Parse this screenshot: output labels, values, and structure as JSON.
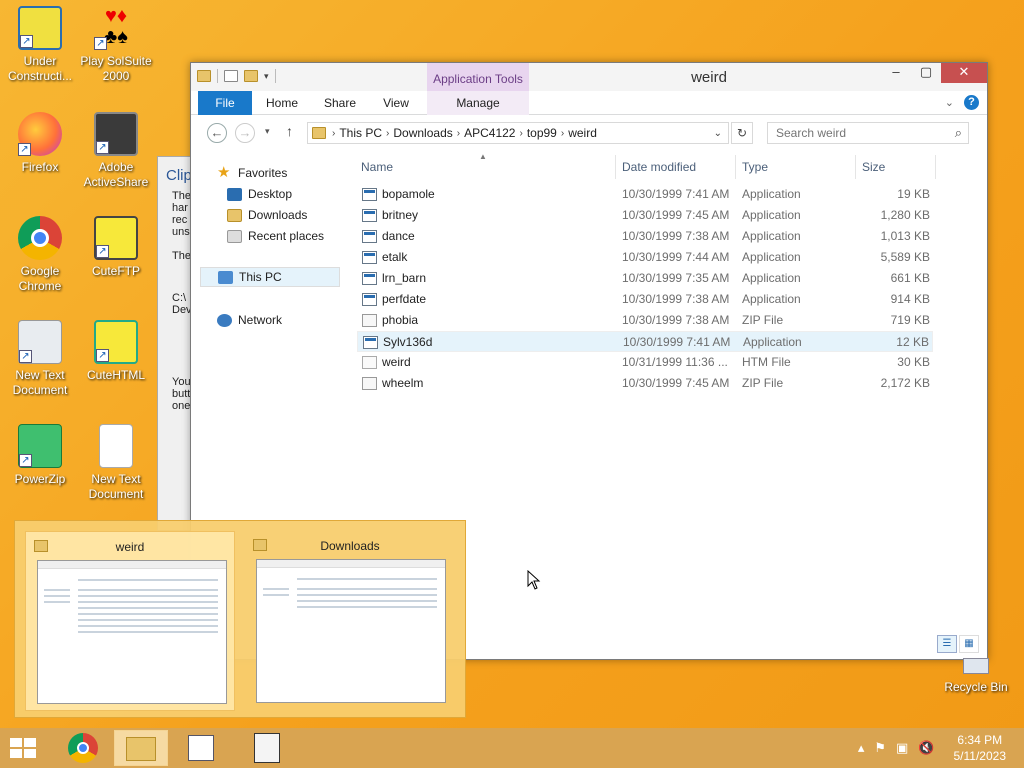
{
  "desktop": {
    "icons": [
      {
        "label": "Under Constructi...",
        "name": "desktop-icon-under-construction"
      },
      {
        "label": "Play SolSuite 2000",
        "name": "desktop-icon-solsuite"
      },
      {
        "label": "Firefox",
        "name": "desktop-icon-firefox"
      },
      {
        "label": "Adobe ActiveShare",
        "name": "desktop-icon-adobe-activeshare"
      },
      {
        "label": "Google Chrome",
        "name": "desktop-icon-google-chrome"
      },
      {
        "label": "CuteFTP",
        "name": "desktop-icon-cuteftp"
      },
      {
        "label": "New Text Document",
        "name": "desktop-icon-new-text-document-1"
      },
      {
        "label": "CuteHTML",
        "name": "desktop-icon-cutehtml"
      },
      {
        "label": "PowerZip",
        "name": "desktop-icon-powerzip"
      },
      {
        "label": "New Text Document",
        "name": "desktop-icon-new-text-document-2"
      }
    ],
    "recycle_bin": "Recycle Bin",
    "bg_window": {
      "title": "Clip",
      "lines": [
        "The",
        "har",
        "rec",
        "uns",
        "The",
        "C:\\",
        "Dev",
        "You",
        "butt",
        "one"
      ]
    }
  },
  "explorer": {
    "title": "weird",
    "contextual_tab": "Application Tools",
    "ribbon_tabs": {
      "file": "File",
      "home": "Home",
      "share": "Share",
      "view": "View",
      "manage": "Manage"
    },
    "help": "?",
    "breadcrumb": [
      "This PC",
      "Downloads",
      "APC4122",
      "top99",
      "weird"
    ],
    "search_placeholder": "Search weird",
    "nav": {
      "favorites": "Favorites",
      "desktop": "Desktop",
      "downloads": "Downloads",
      "recent": "Recent places",
      "this_pc": "This PC",
      "network": "Network"
    },
    "columns": {
      "name": "Name",
      "date": "Date modified",
      "type": "Type",
      "size": "Size"
    },
    "files": [
      {
        "name": "bopamole",
        "date": "10/30/1999 7:41 AM",
        "type": "Application",
        "size": "19 KB",
        "kind": "app"
      },
      {
        "name": "britney",
        "date": "10/30/1999 7:45 AM",
        "type": "Application",
        "size": "1,280 KB",
        "kind": "app"
      },
      {
        "name": "dance",
        "date": "10/30/1999 7:38 AM",
        "type": "Application",
        "size": "1,013 KB",
        "kind": "app"
      },
      {
        "name": "etalk",
        "date": "10/30/1999 7:44 AM",
        "type": "Application",
        "size": "5,589 KB",
        "kind": "app"
      },
      {
        "name": "lrn_barn",
        "date": "10/30/1999 7:35 AM",
        "type": "Application",
        "size": "661 KB",
        "kind": "app"
      },
      {
        "name": "perfdate",
        "date": "10/30/1999 7:38 AM",
        "type": "Application",
        "size": "914 KB",
        "kind": "app"
      },
      {
        "name": "phobia",
        "date": "10/30/1999 7:38 AM",
        "type": "ZIP File",
        "size": "719 KB",
        "kind": "zip"
      },
      {
        "name": "Sylv136d",
        "date": "10/30/1999 7:41 AM",
        "type": "Application",
        "size": "12 KB",
        "kind": "app"
      },
      {
        "name": "weird",
        "date": "10/31/1999 11:36 ...",
        "type": "HTM File",
        "size": "30 KB",
        "kind": "htm"
      },
      {
        "name": "wheelm",
        "date": "10/30/1999 7:45 AM",
        "type": "ZIP File",
        "size": "2,172 KB",
        "kind": "zip"
      }
    ]
  },
  "thumbnails": [
    {
      "title": "weird"
    },
    {
      "title": "Downloads"
    }
  ],
  "taskbar": {
    "time": "6:34 PM",
    "date": "5/11/2023"
  },
  "colors": {
    "desktop": "#f5a623",
    "file_tab": "#1979ca",
    "close": "#c75050",
    "contextual": "#e8d5ef"
  }
}
